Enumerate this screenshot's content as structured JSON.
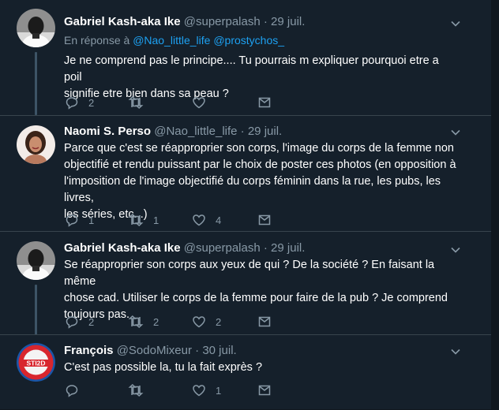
{
  "tweets": [
    {
      "name": "Gabriel Kash-aka Ike",
      "handle": "@superpalash",
      "separator": "·",
      "date": "29 juil.",
      "reply_prefix": "En réponse à",
      "reply_handles": [
        "@Nao_little_life",
        "@prostychos_"
      ],
      "text_lines": [
        "Je ne comprend pas le principe.... Tu pourrais m expliquer pourquoi etre a poil",
        "signifie etre bien dans sa peau ?"
      ],
      "replies": "2",
      "retweets": "",
      "likes": ""
    },
    {
      "name": "Naomi S. Perso",
      "handle": "@Nao_little_life",
      "separator": "·",
      "date": "29 juil.",
      "text_lines": [
        "Parce que c'est se réapproprier son corps, l'image du corps de la femme non",
        "objectifié et rendu puissant par le choix de poster ces photos (en opposition à",
        "l'imposition de l'image objectifié du corps féminin dans la rue, les pubs, les livres,",
        "les séries, etc...)"
      ],
      "replies": "1",
      "retweets": "1",
      "likes": "4"
    },
    {
      "name": "Gabriel Kash-aka Ike",
      "handle": "@superpalash",
      "separator": "·",
      "date": "29 juil.",
      "text_lines": [
        "Se réapproprier son corps aux yeux de qui ?  De la société ?  En faisant la même",
        "chose cad. Utiliser le corps de la femme pour faire de la pub ?  Je comprend",
        "toujours pas."
      ],
      "replies": "2",
      "retweets": "2",
      "likes": "2"
    },
    {
      "name": "François",
      "handle": "@SodoMixeur",
      "separator": "·",
      "date": "30 juil.",
      "text_lines": [
        "C'est pas possible la, tu la fait exprès ?"
      ],
      "replies": "",
      "retweets": "",
      "likes": "1",
      "avatar_text": "STI2D"
    }
  ],
  "colors": {
    "background": "#15202b",
    "text": "#ffffff",
    "muted": "#8899a6",
    "link": "#1da1f2",
    "thread_line": "#3d5466",
    "divider": "#38444d"
  },
  "icons": [
    "reply-icon",
    "retweet-icon",
    "like-icon",
    "dm-icon",
    "caret-down-icon"
  ]
}
